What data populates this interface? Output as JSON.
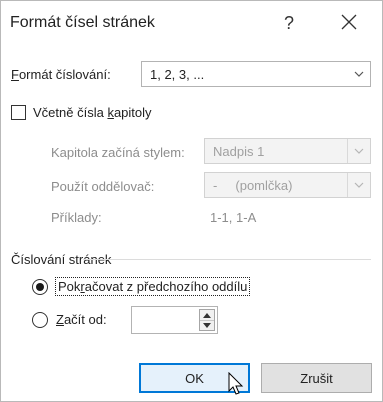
{
  "dialog": {
    "title": "Formát čísel stránek",
    "help": "?",
    "close_icon": "close-icon"
  },
  "format": {
    "label_prefix": "",
    "label_accel": "F",
    "label_rest": "ormát číslování:",
    "value": "1, 2, 3, ..."
  },
  "include_chapter": {
    "label_prefix": "Včetně čísla ",
    "label_accel": "k",
    "label_rest": "apitoly",
    "checked": false
  },
  "chapter": {
    "starts_with_label": "Kapitola začíná stylem:",
    "starts_with_value": "Nadpis 1",
    "separator_label": "Použít oddělovač:",
    "separator_value": "-     (pomlčka)",
    "examples_label": "Příklady:",
    "examples_value": "1-1, 1-A"
  },
  "numbering": {
    "section_title": "Číslování stránek",
    "continue_prefix": "Pok",
    "continue_accel": "r",
    "continue_rest": "ačovat z předchozího oddílu",
    "start_prefix": "",
    "start_accel": "Z",
    "start_rest": "ačít od:",
    "start_value": "",
    "selected": "continue"
  },
  "buttons": {
    "ok": "OK",
    "cancel": "Zrušit"
  },
  "colors": {
    "accent": "#0078d7",
    "disabled_text": "#8d8d8d"
  }
}
